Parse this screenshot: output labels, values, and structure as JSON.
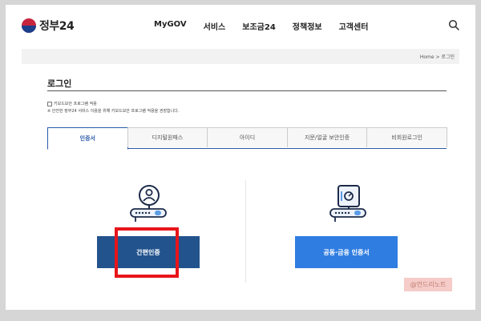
{
  "header": {
    "logo_text": "정부24",
    "nav": [
      "MyGOV",
      "서비스",
      "보조금24",
      "정책정보",
      "고객센터"
    ]
  },
  "breadcrumb": "Home > 로그인",
  "page_title": "로그인",
  "keyboard_security": {
    "checkbox_label": "키보드보안 프로그램 적용",
    "notice": "※ 안전한 정부24 서비스 이용을 위해 키보드보안 프로그램 적용을 권장합니다."
  },
  "tabs": [
    "인증서",
    "디지털원패스",
    "아이디",
    "지문/얼굴 보안인증",
    "비회원로그인"
  ],
  "buttons": {
    "simple_auth": "간편인증",
    "financial_cert": "공동·금융 인증서"
  },
  "watermark": "@언드리노트",
  "colors": {
    "primary_dark": "#22538d",
    "primary_light": "#2f7de1",
    "highlight": "#e8151b"
  }
}
